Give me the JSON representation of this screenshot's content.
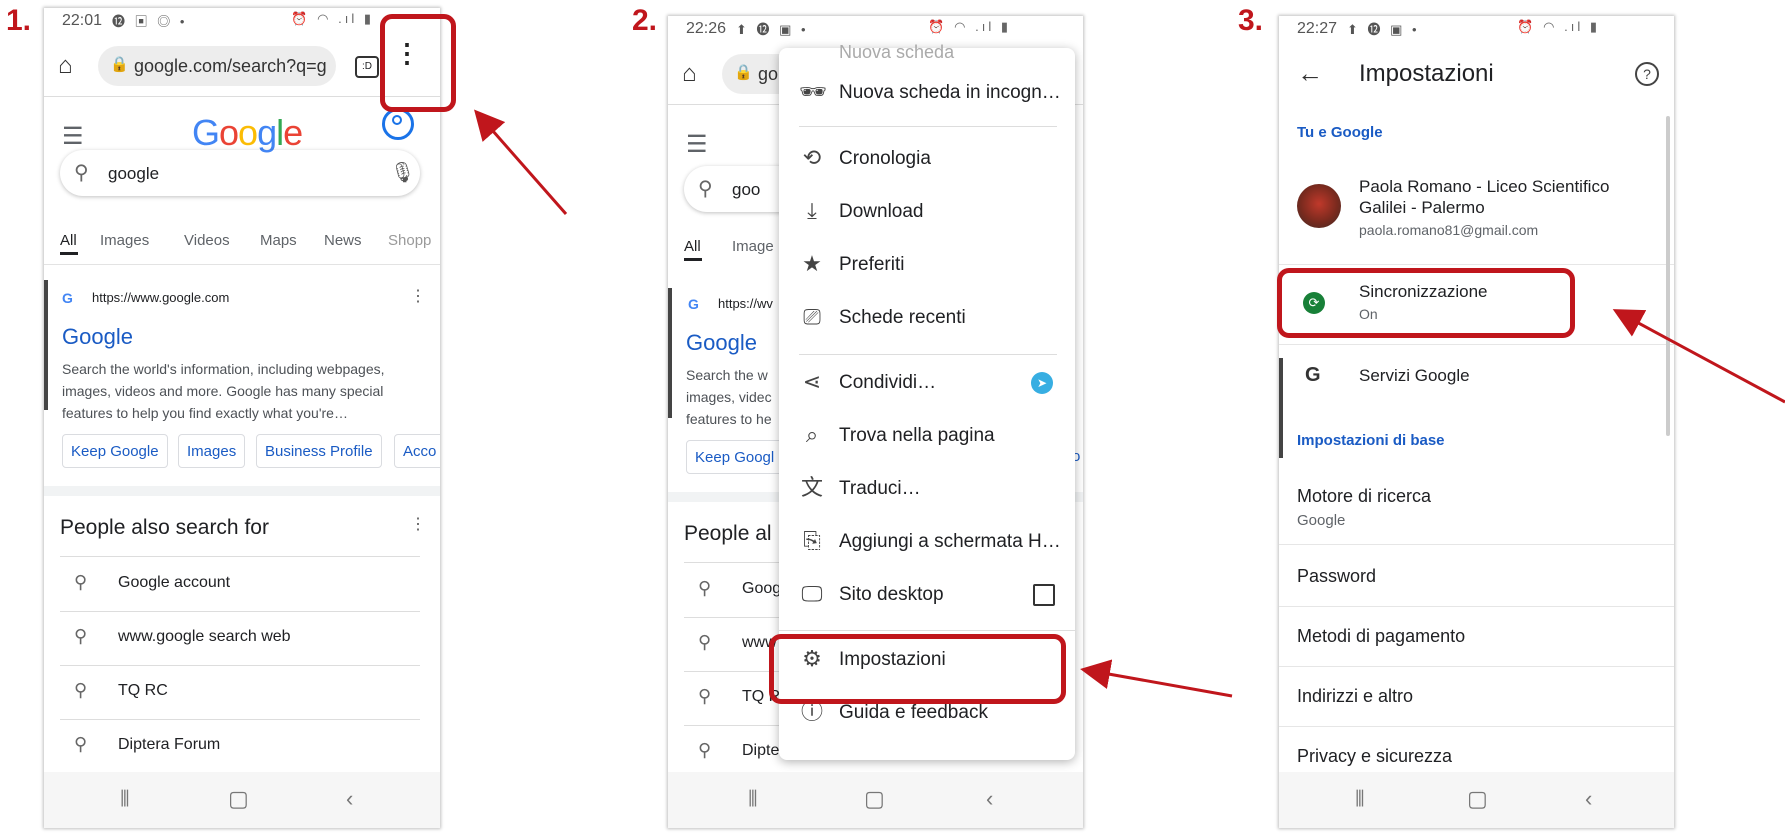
{
  "steps": [
    "1.",
    "2.",
    "3."
  ],
  "status": {
    "time1": "22:01",
    "time2": "22:26",
    "time3": "22:27",
    "left_icons1": "⓬ ▣ ◎ •",
    "left_icons2": "⬆ ⓬ ▣ •",
    "right_icons": "⏰ ◠ .ıl ▮"
  },
  "phone1": {
    "url": "google.com/search?q=g",
    "tab_count": ":D",
    "logo": "Google",
    "search_value": "google",
    "tabs": [
      "All",
      "Images",
      "Videos",
      "Maps",
      "News",
      "Shopp"
    ],
    "result": {
      "url": "https://www.google.com",
      "title": "Google",
      "snippet_1": "Search the world's information, including webpages,",
      "snippet_2": "images, videos and more. Google has many special",
      "snippet_3": "features to help you find exactly what you're…"
    },
    "chips": [
      "Keep Google",
      "Images",
      "Business Profile",
      "Acco"
    ],
    "pasf_title": "People also search for",
    "pasf": [
      "Google account",
      "www.google search web",
      "TQ RC",
      "Diptera Forum"
    ]
  },
  "phone2": {
    "url_partial": "go",
    "search_partial": "goo",
    "tabs": [
      "All",
      "Image"
    ],
    "result_url": "https://wv",
    "result_title": "Google",
    "snippet_1": "Search the w",
    "snippet_2": "images, videc",
    "snippet_3": "features to he",
    "chip": "Keep Googl",
    "chip_partial": "o",
    "pasf_partial": "People al",
    "pasf": [
      "Goog",
      "www",
      "TQ R",
      "Diptera Forum"
    ],
    "menu": {
      "faded": "Nuova scheda",
      "items": [
        "Nuova scheda in incogn…",
        "Cronologia",
        "Download",
        "Preferiti",
        "Schede recenti",
        "Condividi…",
        "Trova nella pagina",
        "Traduci…",
        "Aggiungi a schermata H…",
        "Sito desktop",
        "Impostazioni",
        "Guida e feedback"
      ]
    }
  },
  "phone3": {
    "title": "Impostazioni",
    "section_1": "Tu e Google",
    "account_name_1": "Paola Romano - Liceo Scientifico",
    "account_name_2": "Galilei - Palermo",
    "account_email": "paola.romano81@gmail.com",
    "sync_label": "Sincronizzazione",
    "sync_value": "On",
    "services": "Servizi Google",
    "section_2": "Impostazioni di base",
    "engine_label": "Motore di ricerca",
    "engine_value": "Google",
    "items": [
      "Password",
      "Metodi di pagamento",
      "Indirizzi e altro",
      "Privacy e sicurezza"
    ]
  },
  "colors": {
    "accent_red": "#c0161c",
    "link_blue": "#1a5bc4",
    "sync_green": "#188038"
  }
}
